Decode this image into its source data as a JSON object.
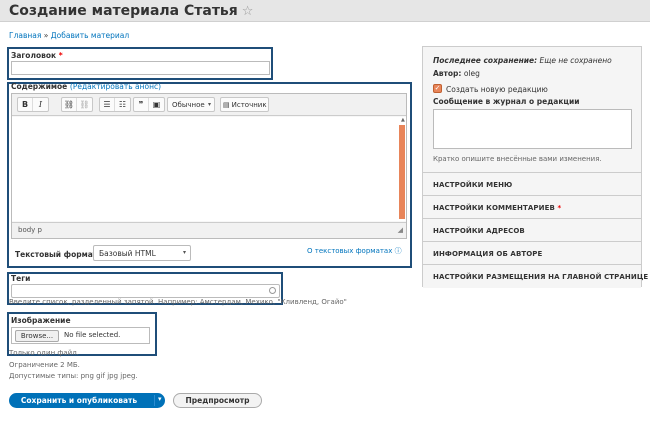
{
  "header": {
    "title": "Создание материала Статья"
  },
  "breadcrumb": {
    "home": "Главная",
    "separator": "»",
    "current": "Добавить материал"
  },
  "title_field": {
    "label": "Заголовок",
    "required": "*",
    "value": ""
  },
  "body_field": {
    "label": "Содержимое",
    "summary_link": "(Редактировать анонс)",
    "toolbar": {
      "bold": "B",
      "italic": "I",
      "format_select": "Обычное",
      "source": "Источник"
    },
    "status_path": "body  p",
    "text_format_label": "Текстовый формат",
    "text_format_value": "Базовый HTML",
    "text_format_help_link": "О текстовых форматах"
  },
  "tags_field": {
    "label": "Теги",
    "value": "",
    "help": "Введите список, разделенный запятой. Например: Амстердам, Мехико, \"Кливленд, Огайо\""
  },
  "image_field": {
    "label": "Изображение",
    "browse": "Browse...",
    "no_file": "No file selected.",
    "help1": "Только один файл.",
    "help2": "Ограничение 2 МБ.",
    "help3": "Допустимые типы: png gif jpg jpeg."
  },
  "actions": {
    "save": "Сохранить и опубликовать",
    "preview": "Предпросмотр"
  },
  "sidebar": {
    "last_saved_label": "Последнее сохранение:",
    "last_saved_value": "Еще не сохранено",
    "author_label": "Автор:",
    "author_value": "oleg",
    "new_revision": "Создать новую редакцию",
    "log_label": "Сообщение в журнал о редакции",
    "log_help": "Кратко опишите внесённые вами изменения.",
    "items": [
      {
        "label": "Настройки меню",
        "required": ""
      },
      {
        "label": "Настройки комментариев",
        "required": "*"
      },
      {
        "label": "Настройки адресов",
        "required": ""
      },
      {
        "label": "Информация об авторе",
        "required": ""
      },
      {
        "label": "Настройки размещения на главной странице",
        "required": ""
      }
    ]
  },
  "colors": {
    "accent": "#0071b8",
    "highlight_box": "#1f4e79",
    "checkbox": "#e8855a"
  }
}
